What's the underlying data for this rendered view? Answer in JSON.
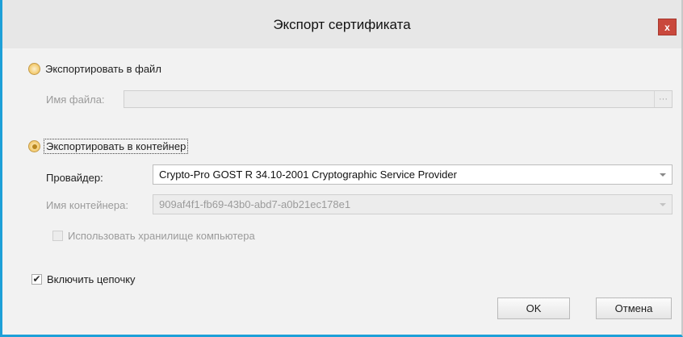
{
  "window": {
    "title": "Экспорт сертификата",
    "close_label": "x"
  },
  "export_file": {
    "radio_label": "Экспортировать в файл",
    "filename_label": "Имя файла:",
    "filename_value": "",
    "browse_label": "···"
  },
  "export_container": {
    "radio_label": "Экспортировать в контейнер",
    "provider_label": "Провайдер:",
    "provider_value": "Crypto-Pro GOST R 34.10-2001 Cryptographic Service Provider",
    "container_label": "Имя контейнера:",
    "container_value": "909af4f1-fb69-43b0-abd7-a0b21ec178e1",
    "use_machine_store_label": "Использовать хранилище компьютера"
  },
  "include_chain": {
    "label": "Включить цепочку",
    "checked": true,
    "check_glyph": "✔"
  },
  "buttons": {
    "ok_label": "OK",
    "cancel_label": "Отмена"
  },
  "colors": {
    "accent_border": "#1ea0d8",
    "close_button": "#c9483c",
    "radio_fill": "#f3c96a"
  }
}
